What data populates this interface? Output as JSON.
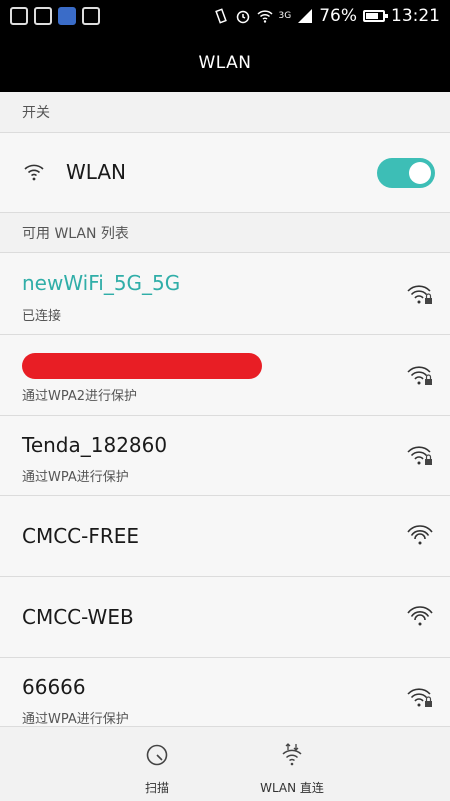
{
  "status_bar": {
    "battery": "76%",
    "time": "13:21",
    "network": "3G",
    "battery_level": 0.76,
    "icons": [
      "image-icon",
      "gallery-icon",
      "app-icon",
      "android-icon",
      "vibrate-icon",
      "alarm-icon",
      "wifi-icon",
      "signal-icon",
      "battery-icon"
    ]
  },
  "header": {
    "title": "WLAN"
  },
  "switch_section": {
    "header": "开关",
    "wlan_label": "WLAN",
    "wlan_enabled": true,
    "accent": "#3dbeb6"
  },
  "available_section": {
    "header": "可用 WLAN 列表"
  },
  "networks": [
    {
      "name": "newWiFi_5G_5G",
      "status": "已连接",
      "secured": true,
      "connected": true
    },
    {
      "name": "",
      "status": "通过WPA2进行保护",
      "secured": true,
      "redacted": true
    },
    {
      "name": "Tenda_182860",
      "status": "通过WPA进行保护",
      "secured": true
    },
    {
      "name": "CMCC-FREE",
      "status": "",
      "secured": false
    },
    {
      "name": "CMCC-WEB",
      "status": "",
      "secured": false
    },
    {
      "name": "66666",
      "status": "通过WPA进行保护",
      "secured": true
    }
  ],
  "bottom_bar": {
    "scan_label": "扫描",
    "direct_label": "WLAN 直连"
  },
  "colors": {
    "accent": "#30aea8",
    "redaction": "#e81e25"
  }
}
